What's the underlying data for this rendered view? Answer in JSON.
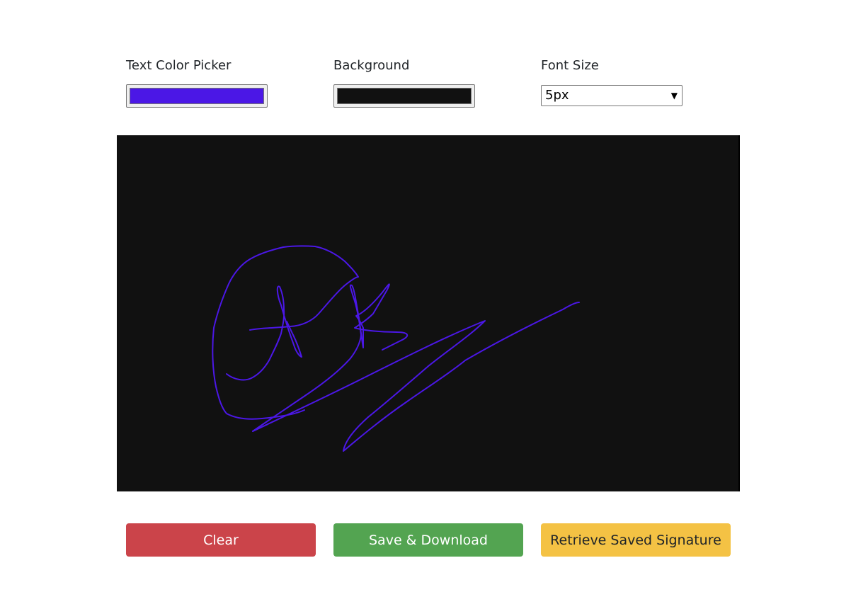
{
  "controls": {
    "text_color": {
      "label": "Text Color Picker",
      "value": "#4b17e6"
    },
    "background": {
      "label": "Background",
      "value": "#111111"
    },
    "font_size": {
      "label": "Font Size",
      "selected": "5px"
    }
  },
  "canvas": {
    "background": "#111111",
    "stroke_color": "#4b17e6"
  },
  "buttons": {
    "clear": "Clear",
    "save": "Save & Download",
    "retrieve": "Retrieve Saved Signature"
  },
  "colors": {
    "danger": "#cb444a",
    "success": "#53a451",
    "warning": "#f4c244"
  }
}
